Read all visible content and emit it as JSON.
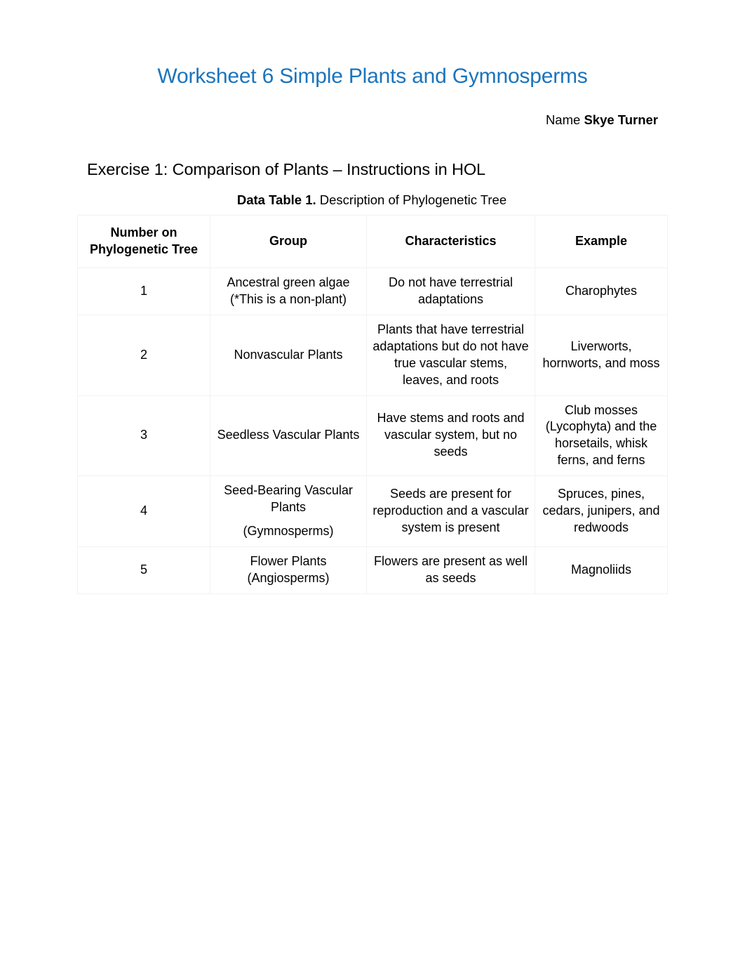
{
  "document": {
    "title": "Worksheet 6 Simple Plants and Gymnosperms",
    "title_color": "#1B74BC",
    "name_label": "Name ",
    "name_value": "Skye Turner",
    "exercise_heading": "Exercise 1: Comparison of Plants – Instructions in HOL",
    "caption_strong": "Data Table 1.",
    "caption_rest": " Description of Phylogenetic Tree"
  },
  "table": {
    "headers": [
      "Number on Phylogenetic Tree",
      "Group",
      "Characteristics",
      "Example"
    ],
    "header_line1": "Number on",
    "header_line2": "Phylogenetic Tree",
    "rows": [
      {
        "number": "1",
        "group_line1": "Ancestral green algae",
        "group_line2": "(*This is a non-plant)",
        "group": "Ancestral green algae (*This is a non-plant)",
        "characteristics": "Do not have terrestrial adaptations",
        "example": "Charophytes"
      },
      {
        "number": "2",
        "group_line1": "Nonvascular Plants",
        "group_line2": "",
        "group": "Nonvascular Plants",
        "characteristics": "Plants that have terrestrial adaptations but do not have true vascular stems, leaves, and roots",
        "example": "Liverworts, hornworts, and moss"
      },
      {
        "number": "3",
        "group_line1": "Seedless Vascular Plants",
        "group_line2": "",
        "group": "Seedless Vascular Plants",
        "characteristics": "Have stems and roots and vascular system, but no seeds",
        "example": "Club mosses (Lycophyta) and the horsetails, whisk ferns, and ferns"
      },
      {
        "number": "4",
        "group_line1": "Seed-Bearing Vascular Plants",
        "group_line2": "(Gymnosperms)",
        "group": "Seed-Bearing Vascular Plants (Gymnosperms)",
        "characteristics": "Seeds are present for reproduction and a vascular system is present",
        "example": "Spruces, pines, cedars, junipers, and redwoods"
      },
      {
        "number": "5",
        "group_line1": "Flower Plants",
        "group_line2": "(Angiosperms)",
        "group": "Flower Plants (Angiosperms)",
        "characteristics": "Flowers are present as well as seeds",
        "example": "Magnoliids"
      }
    ]
  }
}
